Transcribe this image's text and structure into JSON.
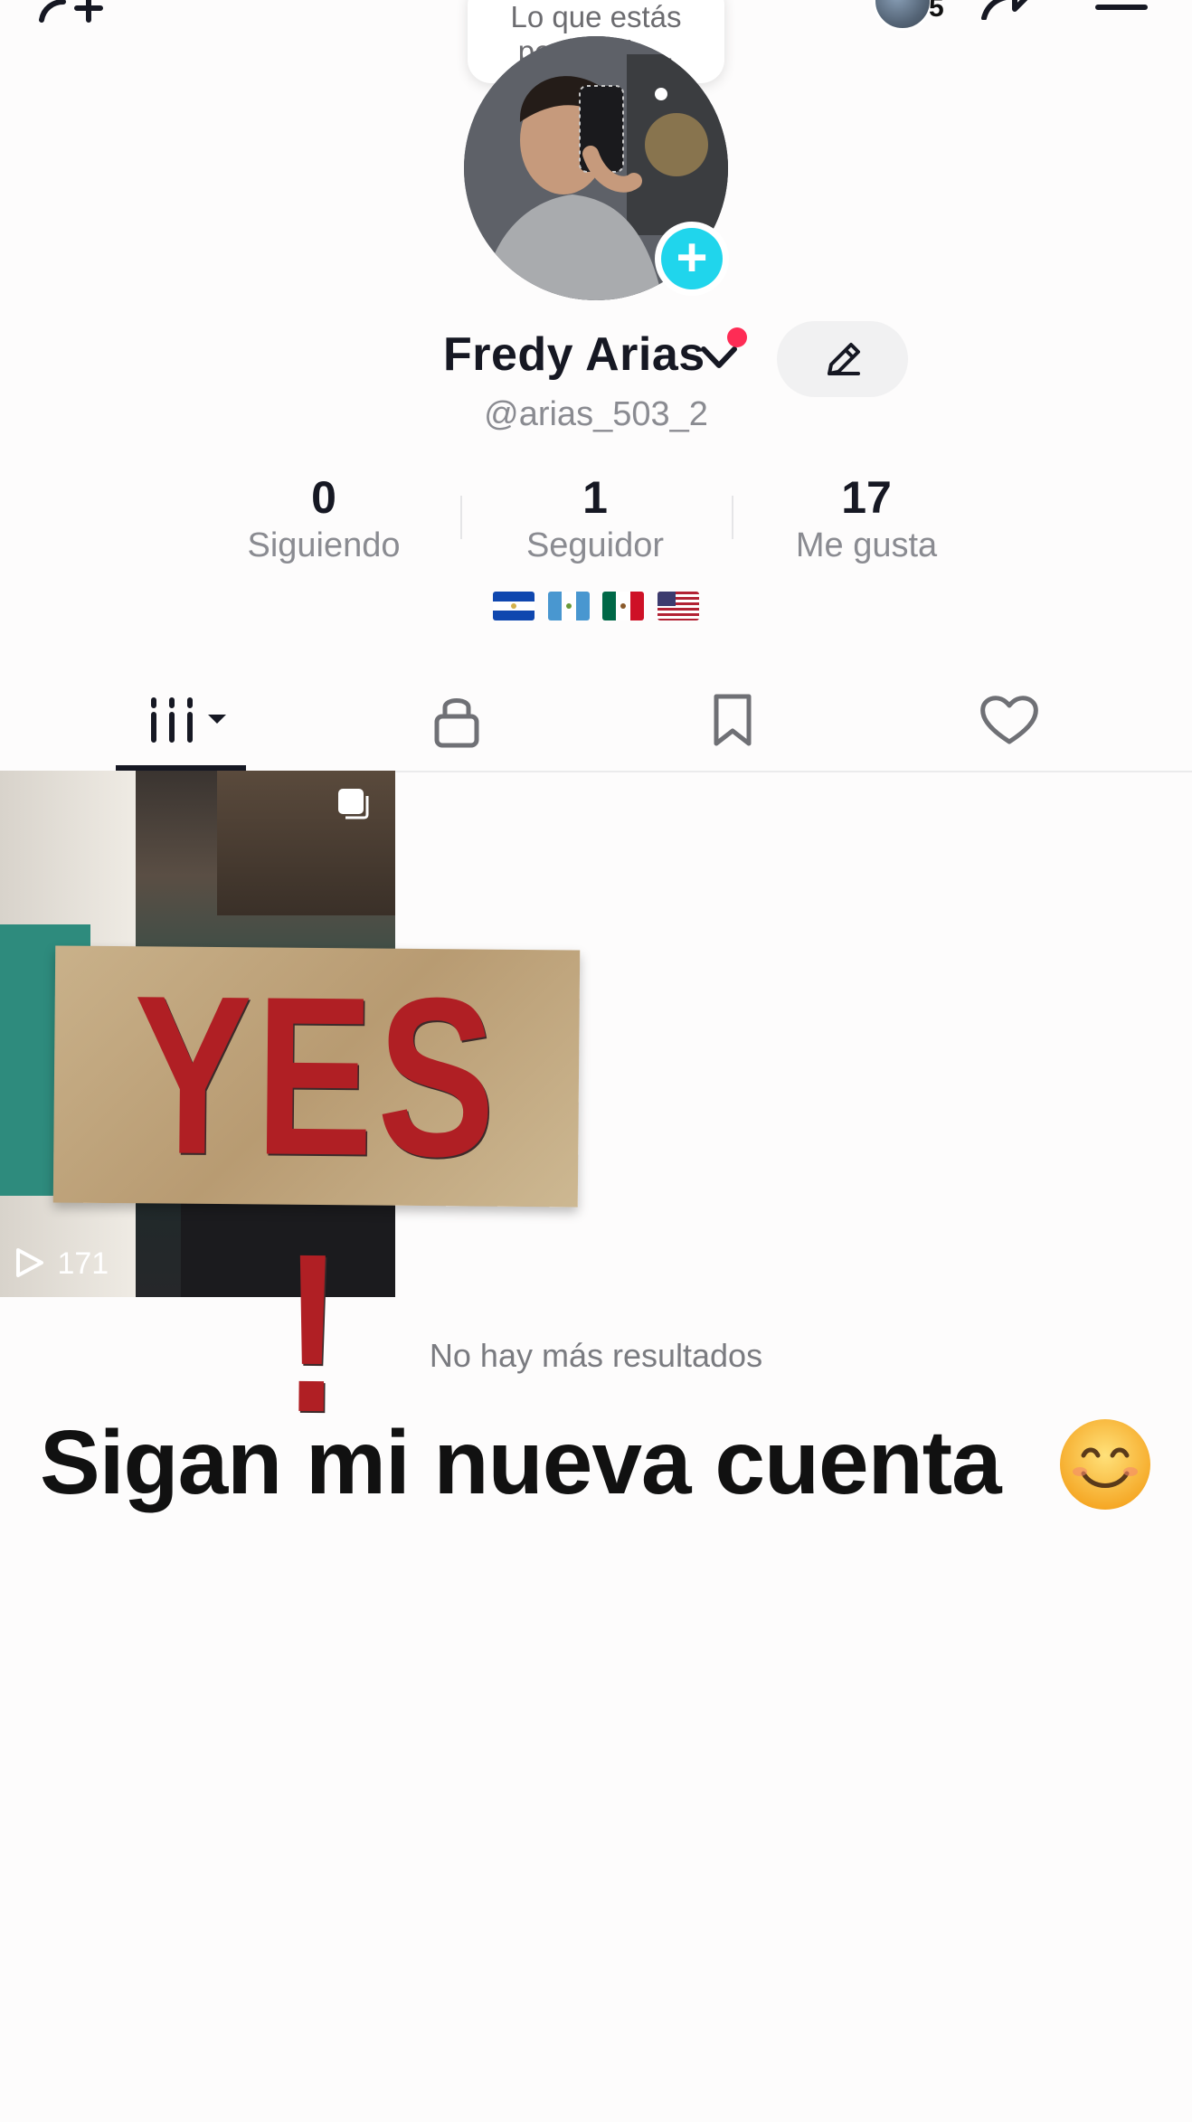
{
  "header": {
    "story_count": "5"
  },
  "bubble": {
    "text": "Lo que estás pensando..."
  },
  "profile": {
    "display_name": "Fredy Arias",
    "username": "@arias_503_2"
  },
  "stats": [
    {
      "value": "0",
      "label": "Siguiendo"
    },
    {
      "value": "1",
      "label": "Seguidor"
    },
    {
      "value": "17",
      "label": "Me gusta"
    }
  ],
  "flags": [
    "el-salvador-flag",
    "guatemala-flag",
    "mexico-flag",
    "usa-flag"
  ],
  "tabs": [
    "videos-grid-icon",
    "lock-icon",
    "bookmark-icon",
    "heart-icon"
  ],
  "videos": [
    {
      "views": "171",
      "sticker_text": "YES !"
    }
  ],
  "footer": {
    "no_more": "No hay más resultados",
    "message": "Sigan mi nueva cuenta"
  },
  "colors": {
    "accent_red": "#fe2c55",
    "story_plus": "#20d5ec",
    "text_primary": "#161823",
    "text_secondary": "#8a8b91"
  }
}
